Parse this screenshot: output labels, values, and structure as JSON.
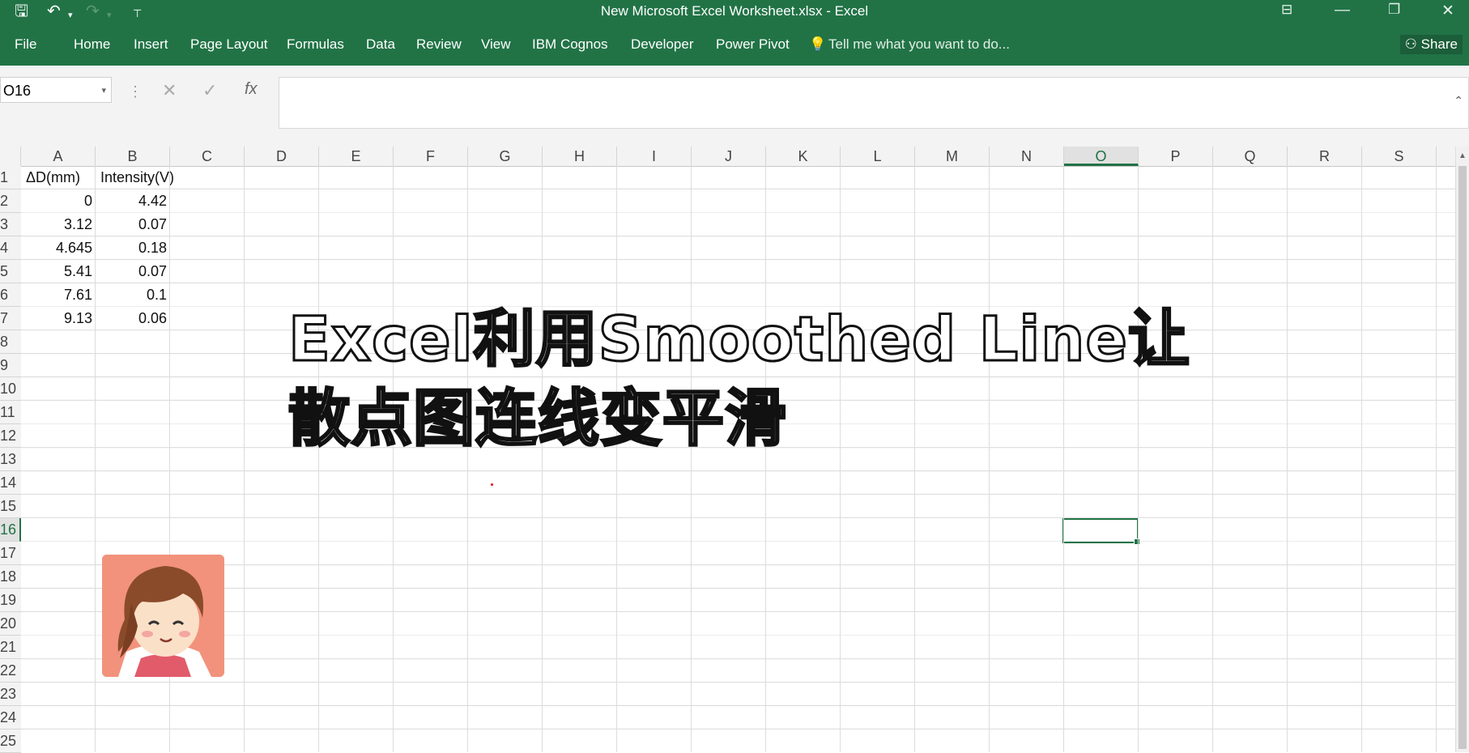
{
  "window": {
    "title": "New Microsoft Excel Worksheet.xlsx - Excel",
    "controls": [
      "ribbon-display-icon",
      "minimize-icon",
      "restore-icon",
      "close-icon"
    ]
  },
  "ribbon": {
    "tabs": [
      "File",
      "Home",
      "Insert",
      "Page Layout",
      "Formulas",
      "Data",
      "Review",
      "View",
      "IBM Cognos",
      "Developer",
      "Power Pivot"
    ],
    "tell_me": "Tell me what you want to do...",
    "share": "Share"
  },
  "formula_bar": {
    "name_box": "O16",
    "value": ""
  },
  "grid": {
    "columns": [
      "A",
      "B",
      "C",
      "D",
      "E",
      "F",
      "G",
      "H",
      "I",
      "J",
      "K",
      "L",
      "M",
      "N",
      "O",
      "P",
      "Q",
      "R",
      "S"
    ],
    "rows": [
      "1",
      "2",
      "3",
      "4",
      "5",
      "6",
      "7",
      "8",
      "9",
      "10",
      "11",
      "12",
      "13",
      "14",
      "15",
      "16",
      "17",
      "18",
      "19",
      "20",
      "21",
      "22",
      "23",
      "24",
      "25"
    ],
    "selected_column": "O",
    "selected_row": "16",
    "header_row": [
      "ΔD(mm)",
      "Intensity(V)"
    ],
    "data": [
      [
        "0",
        "4.42"
      ],
      [
        "3.12",
        "0.07"
      ],
      [
        "4.645",
        "0.18"
      ],
      [
        "5.41",
        "0.07"
      ],
      [
        "7.61",
        "0.1"
      ],
      [
        "9.13",
        "0.06"
      ]
    ]
  },
  "overlay": {
    "line1": "Excel利用Smoothed Line让",
    "line2": "散点图连线变平滑"
  }
}
